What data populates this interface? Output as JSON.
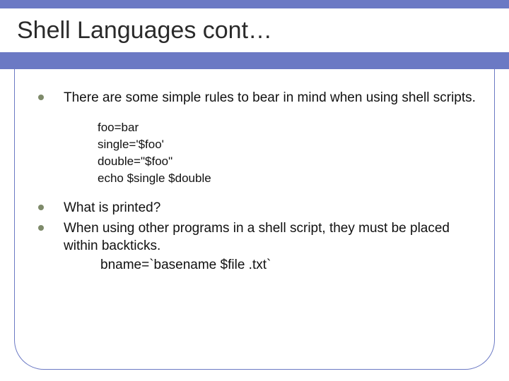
{
  "title": "Shell Languages cont…",
  "bullets": {
    "b1": "There are some simple rules to bear in mind when using shell scripts.",
    "b2": "What is printed?",
    "b3": "When using other programs in a shell script, they must be placed within backticks."
  },
  "code": {
    "l1": "foo=bar",
    "l2": "single='$foo'",
    "l3": "double=\"$foo\"",
    "l4": "echo $single $double",
    "b3_example": "bname=`basename $file .txt`"
  }
}
